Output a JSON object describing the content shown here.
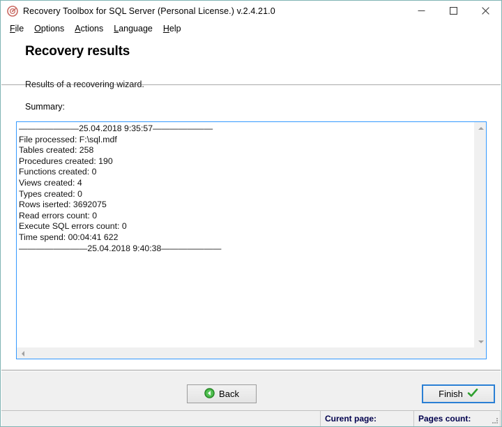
{
  "window": {
    "title": "Recovery Toolbox for SQL Server (Personal License.) v.2.4.21.0",
    "icon": "app-logo-icon",
    "controls": {
      "minimize": "minimize-icon",
      "maximize": "maximize-icon",
      "close": "close-icon"
    },
    "border_color": "#7fb3b3"
  },
  "menubar": {
    "items": [
      {
        "label": "File",
        "accel": "F"
      },
      {
        "label": "Options",
        "accel": "O"
      },
      {
        "label": "Actions",
        "accel": "A"
      },
      {
        "label": "Language",
        "accel": "L"
      },
      {
        "label": "Help",
        "accel": "H"
      }
    ]
  },
  "page": {
    "title": "Recovery results",
    "subtitle": "Results of a recovering wizard.",
    "summary_label": "Summary:"
  },
  "log": {
    "start_separator": "——————— 25.04.2018 9:35:57———————",
    "start_timestamp": "25.04.2018 9:35:57",
    "end_timestamp": "25.04.2018 9:40:38",
    "lines": [
      "———————25.04.2018 9:35:57———————",
      "File processed: F:\\sql.mdf",
      "Tables created: 258",
      "Procedures created: 190",
      "Functions created: 0",
      "Views created: 4",
      "Types created: 0",
      "Rows iserted: 3692075",
      "Read errors count: 0",
      "Execute SQL errors count: 0",
      "Time spend: 00:04:41 622",
      "————————25.04.2018 9:40:38———————"
    ],
    "text": "———————25.04.2018 9:35:57———————\nFile processed: F:\\sql.mdf\nTables created: 258\nProcedures created: 190\nFunctions created: 0\nViews created: 4\nTypes created: 0\nRows iserted: 3692075\nRead errors count: 0\nExecute SQL errors count: 0\nTime spend: 00:04:41 622\n————————25.04.2018 9:40:38———————",
    "stats": {
      "file_processed": "F:\\sql.mdf",
      "tables_created": 258,
      "procedures_created": 190,
      "functions_created": 0,
      "views_created": 4,
      "types_created": 0,
      "rows_inserted": 3692075,
      "read_errors_count": 0,
      "execute_sql_errors_count": 0,
      "time_spend": "00:04:41 622"
    },
    "scroll": {
      "vertical_up": "scroll-up-arrow-icon",
      "vertical_down": "scroll-down-arrow-icon",
      "horizontal_left": "scroll-left-arrow-icon",
      "horizontal_right": "scroll-right-arrow-icon"
    },
    "focus_border_color": "#3399ff"
  },
  "footer": {
    "back_label": "Back",
    "back_icon": "green-left-arrow-icon",
    "finish_label": "Finish",
    "finish_icon": "green-check-icon",
    "accent_color": "#2a7fd4",
    "icon_green": "#35a935"
  },
  "statusbar": {
    "blank": "",
    "current_page_label": "Curent page:",
    "pages_count_label": "Pages count:",
    "grip": "resize-grip-icon"
  }
}
